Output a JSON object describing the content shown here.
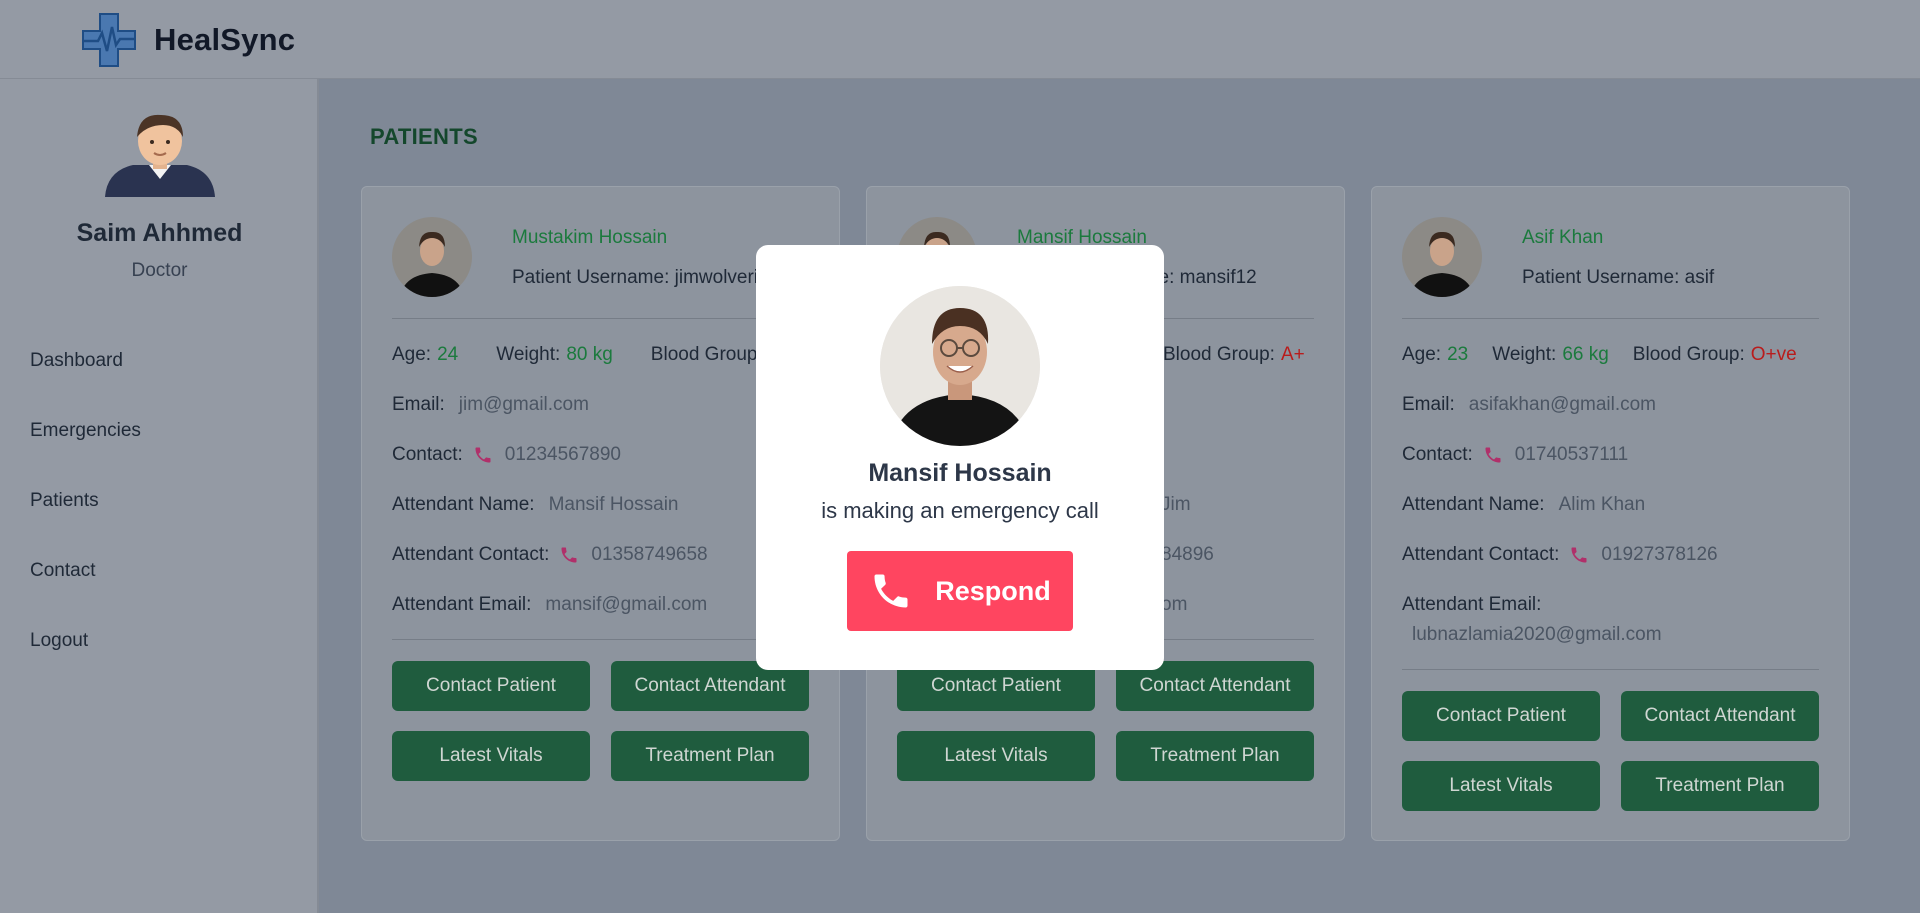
{
  "app": {
    "brand": "HealSync"
  },
  "sidebar": {
    "doctor_name": "Saim Ahhmed",
    "doctor_role": "Doctor",
    "items": [
      {
        "label": "Dashboard"
      },
      {
        "label": "Emergencies"
      },
      {
        "label": "Patients"
      },
      {
        "label": "Contact"
      },
      {
        "label": "Logout"
      }
    ]
  },
  "main": {
    "title": "PATIENTS",
    "labels": {
      "age": "Age:",
      "weight": "Weight:",
      "blood_group": "Blood Group:",
      "email": "Email:",
      "contact": "Contact:",
      "attendant_name": "Attendant Name:",
      "attendant_contact": "Attendant Contact:",
      "attendant_email": "Attendant Email:"
    },
    "buttons": {
      "contact_patient": "Contact Patient",
      "contact_attendant": "Contact Attendant",
      "latest_vitals": "Latest Vitals",
      "treatment_plan": "Treatment Plan"
    },
    "patients": [
      {
        "name": "Mustakim Hossain",
        "username": "Patient Username: jimwolverine",
        "age": "24",
        "weight": "80 kg",
        "blood_group": "",
        "email": "jim@gmail.com",
        "contact": "01234567890",
        "attendant_name": "Mansif Hossain",
        "attendant_contact": "01358749658",
        "attendant_email": "mansif@gmail.com"
      },
      {
        "name": "Mansif Hossain",
        "username": "Patient Username: mansif12",
        "age": "",
        "weight": "",
        "blood_group": "A+",
        "email": "",
        "contact": "",
        "attendant_name": "Jim",
        "attendant_contact": "84896",
        "attendant_email": "om"
      },
      {
        "name": "Asif Khan",
        "username": "Patient Username: asif",
        "age": "23",
        "weight": "66 kg",
        "blood_group": "O+ve",
        "email": "asifakhan@gmail.com",
        "contact": "01740537111",
        "attendant_name": "Alim Khan",
        "attendant_contact": "01927378126",
        "attendant_email": "lubnazlamia2020@gmail.com"
      }
    ]
  },
  "modal": {
    "caller_name": "Mansif Hossain",
    "message": "is making an emergency call",
    "respond_label": "Respond"
  },
  "colors": {
    "accent_green": "#1f5c3e",
    "respond_red": "#ff4560",
    "phone_pink": "#b0306a"
  }
}
